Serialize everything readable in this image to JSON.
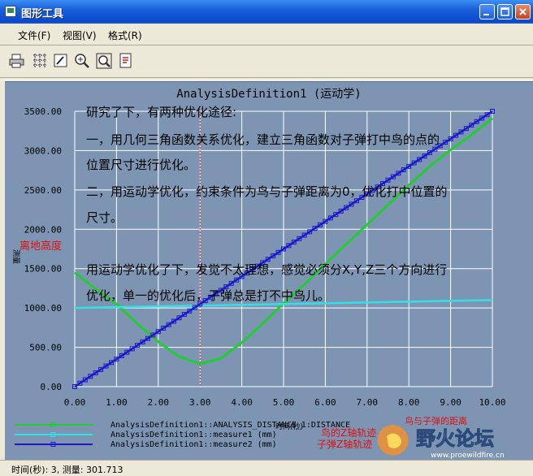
{
  "window": {
    "title": "图形工具"
  },
  "menu": [
    {
      "label": "文件(F)"
    },
    {
      "label": "视图(V)"
    },
    {
      "label": "格式(R)"
    }
  ],
  "chart_data": {
    "type": "line",
    "title": "AnalysisDefinition1 (运动学)",
    "xlabel": "时间(秒)",
    "ylabel": "测量",
    "xlim": [
      0,
      10
    ],
    "ylim": [
      0,
      3500
    ],
    "x_ticks": [
      "0.00",
      "1.00",
      "2.00",
      "3.00",
      "4.00",
      "5.00",
      "6.00",
      "7.00",
      "8.00",
      "9.00",
      "10.00"
    ],
    "y_ticks": [
      "0.00",
      "500.00",
      "1000.00",
      "1500.00",
      "2000.00",
      "2500.00",
      "3000.00",
      "3500.00"
    ],
    "cursor_x": 3,
    "series": [
      {
        "name": "AnalysisDefinition1::ANALYSIS_DISTANCE_1:DISTANCE",
        "color": "#22cc33",
        "x": [
          0,
          0.5,
          1,
          1.5,
          2,
          2.5,
          3,
          3.5,
          4,
          4.5,
          5,
          5.5,
          6,
          6.5,
          7,
          7.5,
          8,
          8.5,
          9,
          9.5,
          10
        ],
        "y": [
          1450,
          1240,
          1050,
          800,
          570,
          380,
          290,
          360,
          560,
          800,
          1060,
          1300,
          1560,
          1810,
          2060,
          2310,
          2560,
          2800,
          3010,
          3200,
          3410
        ]
      },
      {
        "name": "AnalysisDefinition1::measure1 (mm)",
        "color": "#33e0e8",
        "x": [
          0,
          10
        ],
        "y": [
          1000,
          1100
        ]
      },
      {
        "name": "AnalysisDefinition1::measure2 (mm)",
        "color": "#1a1acc",
        "x": [
          0,
          10
        ],
        "y": [
          0,
          3500
        ]
      }
    ]
  },
  "annotations": {
    "lines": [
      "研究了下，有两种优化途径:",
      "一，用几何三角函数关系优化，建立三角函数对子弹打中鸟的点的",
      "位置尺寸进行优化。",
      "二，用运动学优化，约束条件为鸟与子弹距离为0，优化打中位置的",
      "尺寸。",
      "用运动学优化了下，发觉不太理想，感觉必须分X,Y,Z三个方向进行",
      "优化，单一的优化后，子弹总是打不中鸟儿。"
    ],
    "height_label": "离地高度",
    "legend_note_1": "鸟与子弹的距离",
    "legend_note_2": "鸟的Z轴轨迹",
    "legend_note_3": "子弹Z轴轨迹"
  },
  "status": {
    "text": "时间(秒): 3, 测量: 301.713"
  },
  "watermark": {
    "text": "野火论坛",
    "url": "www.proewildfire.cn"
  },
  "colors": {
    "plot_bg": "#7d95b2",
    "grid": "#ffffff",
    "cursor": "#cc2222",
    "annotation_red": "#dd1111"
  }
}
